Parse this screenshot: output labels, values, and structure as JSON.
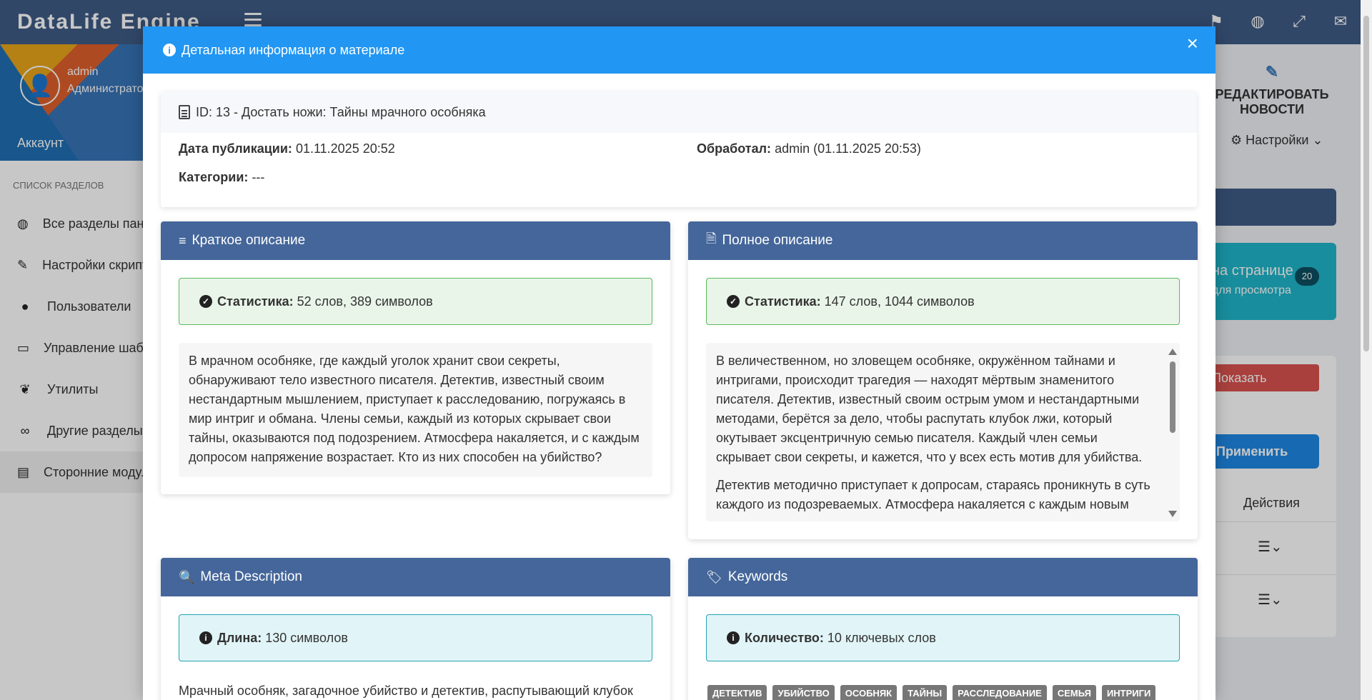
{
  "app": {
    "brand": "DataLife Engine",
    "top_icons": [
      "flag-icon",
      "globe-icon",
      "fullscreen-icon",
      "mail-icon"
    ]
  },
  "sidebar": {
    "user_name": "admin",
    "user_role": "Администратор",
    "account": "Аккаунт",
    "section_title": "Список разделов",
    "items": [
      {
        "label": "Все разделы панели",
        "icon": "globe-icon"
      },
      {
        "label": "Настройки скриптов",
        "icon": "wrench-icon"
      },
      {
        "label": "Пользователи",
        "icon": "user-icon"
      },
      {
        "label": "Управление шаблонами",
        "icon": "laptop-icon"
      },
      {
        "label": "Утилиты",
        "icon": "leaf-icon"
      },
      {
        "label": "Другие разделы",
        "icon": "link-icon"
      },
      {
        "label": "Сторонние модули",
        "icon": "table-icon"
      }
    ]
  },
  "right_panel": {
    "edit_news": "РЕДАКТИРОВАТЬ НОВОСТИ",
    "settings": "Настройки",
    "teal_title": "на странице",
    "teal_sub": "для просмотра",
    "teal_count": "20",
    "unprocessed": "Показать необработанных",
    "apply": "Применить",
    "actions_header": "Действия"
  },
  "modal": {
    "title": "Детальная информация о материале",
    "item_heading": "ID: 13 - Достать ножи: Тайны мрачного особняка",
    "pub_date_label": "Дата публикации:",
    "pub_date_value": "01.11.2025 20:52",
    "processed_label": "Обработал:",
    "processed_value": "admin (01.11.2025 20:53)",
    "categories_label": "Категории:",
    "categories_value": "---",
    "short": {
      "title": "Краткое описание",
      "stat_label": "Статистика:",
      "stat_value": "52 слов, 389 символов",
      "text": "В мрачном особняке, где каждый уголок хранит свои секреты, обнаруживают тело известного писателя. Детектив, известный своим нестандартным мышлением, приступает к расследованию, погружаясь в мир интриг и обмана. Члены семьи, каждый из которых скрывает свои тайны, оказываются под подозрением. Атмосфера накаляется, и с каждым допросом напряжение возрастает. Кто из них способен на убийство?"
    },
    "full": {
      "title": "Полное описание",
      "stat_label": "Статистика:",
      "stat_value": "147 слов, 1044 символов",
      "p1": "В величественном, но зловещем особняке, окружённом тайнами и интригами, происходит трагедия — находят мёртвым знаменитого писателя. Детектив, известный своим острым умом и нестандартными методами, берётся за дело, чтобы распутать клубок лжи, который окутывает эксцентричную семью писателя. Каждый член семьи скрывает свои секреты, и кажется, что у всех есть мотив для убийства.",
      "p2": "Детектив методично приступает к допросам, стараясь проникнуть в суть каждого из подозреваемых. Атмосфера накаляется с каждым новым"
    },
    "meta": {
      "title": "Meta Description",
      "len_label": "Длина:",
      "len_value": "130 символов",
      "text": "Мрачный особняк, загадочное убийство и детектив, распутывающий клубок"
    },
    "keywords": {
      "title": "Keywords",
      "count_label": "Количество:",
      "count_value": "10 ключевых слов",
      "tags": [
        "детектив",
        "убийство",
        "особняк",
        "тайны",
        "расследование",
        "семья",
        "интриги"
      ]
    }
  }
}
